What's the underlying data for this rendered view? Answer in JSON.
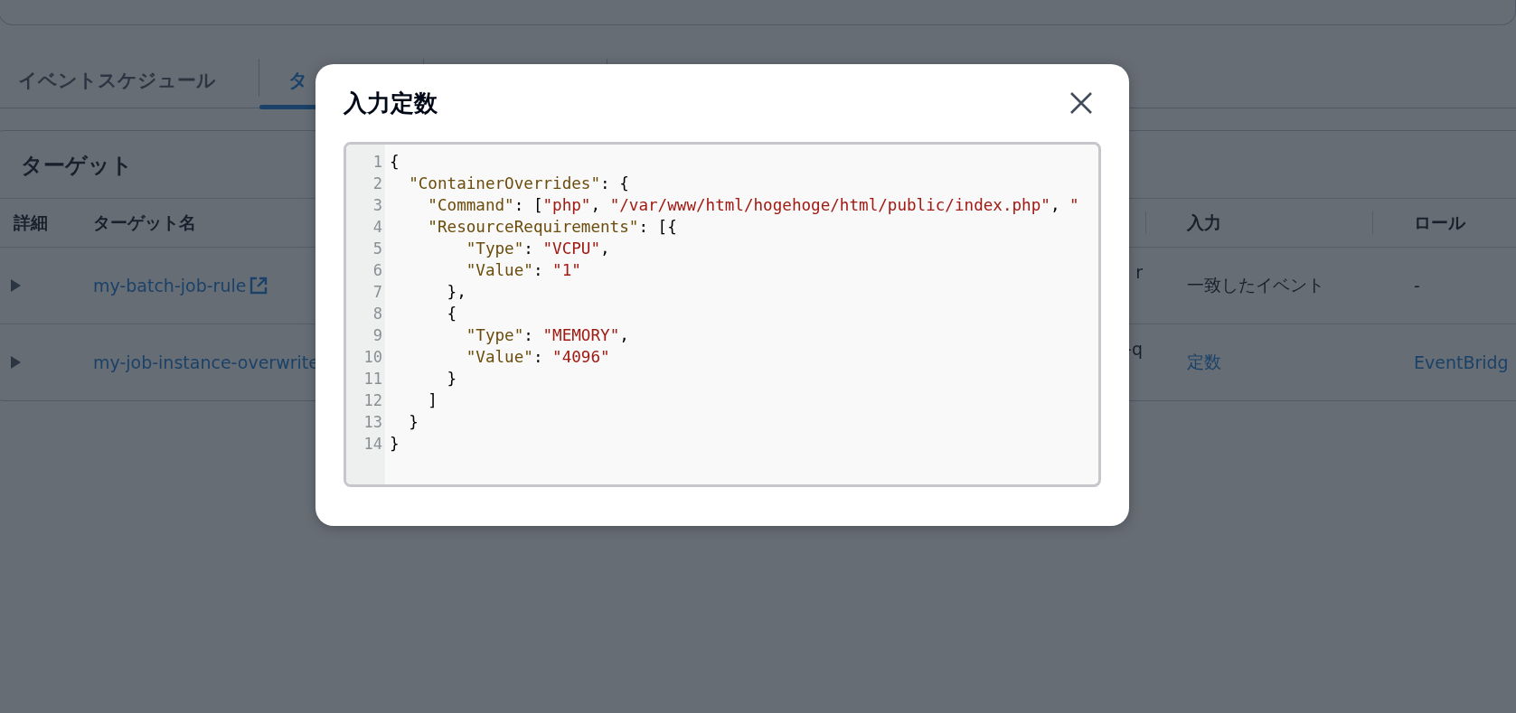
{
  "tabs": [
    {
      "label": "イベントスケジュール",
      "selected": false
    },
    {
      "label": "タ",
      "selected": true
    }
  ],
  "targets": {
    "title": "ターゲット",
    "columns": {
      "details": "詳細",
      "target_name": "ターゲット名",
      "input": "入力",
      "role": "ロール"
    },
    "rows": [
      {
        "expanded": false,
        "target_name": "my-batch-job-rule",
        "external": true,
        "column_3": "r",
        "input": {
          "text": "一致したイベント",
          "link": false
        },
        "role": {
          "text": "-",
          "link": false
        }
      },
      {
        "expanded": false,
        "target_name": "my-job-instance-overwrite",
        "external": false,
        "column_3": "-q",
        "input": {
          "text": "定数",
          "link": true
        },
        "role": {
          "text": "EventBridg",
          "link": true
        }
      }
    ]
  },
  "modal": {
    "title": "入力定数",
    "code_lines": [
      {
        "number": "1",
        "tokens": [
          {
            "kind": "punct",
            "text": "{"
          }
        ]
      },
      {
        "number": "2",
        "tokens": [
          {
            "kind": "key",
            "text": "  \"ContainerOverrides\""
          },
          {
            "kind": "punct",
            "text": ": {"
          }
        ]
      },
      {
        "number": "3",
        "tokens": [
          {
            "kind": "key",
            "text": "    \"Command\""
          },
          {
            "kind": "punct",
            "text": ": ["
          },
          {
            "kind": "string",
            "text": "\"php\""
          },
          {
            "kind": "punct",
            "text": ", "
          },
          {
            "kind": "string",
            "text": "\"/var/www/html/hogehoge/html/public/index.php\""
          },
          {
            "kind": "punct",
            "text": ", "
          },
          {
            "kind": "string",
            "text": "\""
          }
        ]
      },
      {
        "number": "4",
        "tokens": [
          {
            "kind": "key",
            "text": "    \"ResourceRequirements\""
          },
          {
            "kind": "punct",
            "text": ": [{"
          }
        ]
      },
      {
        "number": "5",
        "tokens": [
          {
            "kind": "key",
            "text": "        \"Type\""
          },
          {
            "kind": "punct",
            "text": ": "
          },
          {
            "kind": "string",
            "text": "\"VCPU\""
          },
          {
            "kind": "punct",
            "text": ","
          }
        ]
      },
      {
        "number": "6",
        "tokens": [
          {
            "kind": "key",
            "text": "        \"Value\""
          },
          {
            "kind": "punct",
            "text": ": "
          },
          {
            "kind": "string",
            "text": "\"1\""
          }
        ]
      },
      {
        "number": "7",
        "tokens": [
          {
            "kind": "punct",
            "text": "      },"
          }
        ]
      },
      {
        "number": "8",
        "tokens": [
          {
            "kind": "punct",
            "text": "      {"
          }
        ]
      },
      {
        "number": "9",
        "tokens": [
          {
            "kind": "key",
            "text": "        \"Type\""
          },
          {
            "kind": "punct",
            "text": ": "
          },
          {
            "kind": "string",
            "text": "\"MEMORY\""
          },
          {
            "kind": "punct",
            "text": ","
          }
        ]
      },
      {
        "number": "10",
        "tokens": [
          {
            "kind": "key",
            "text": "        \"Value\""
          },
          {
            "kind": "punct",
            "text": ": "
          },
          {
            "kind": "string",
            "text": "\"4096\""
          }
        ]
      },
      {
        "number": "11",
        "tokens": [
          {
            "kind": "punct",
            "text": "      }"
          }
        ]
      },
      {
        "number": "12",
        "tokens": [
          {
            "kind": "punct",
            "text": "    ]"
          }
        ]
      },
      {
        "number": "13",
        "tokens": [
          {
            "kind": "punct",
            "text": "  }"
          }
        ]
      },
      {
        "number": "14",
        "tokens": [
          {
            "kind": "punct",
            "text": "}"
          }
        ]
      }
    ]
  }
}
